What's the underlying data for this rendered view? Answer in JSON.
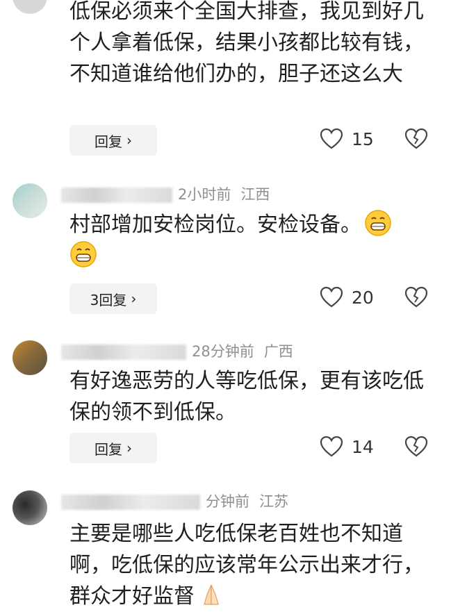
{
  "comments": [
    {
      "text": "低保必须来个全国大排查，我见到好几个人拿着低保，结果小孩都比较有钱，不知道谁给他们办的，胆子还这么大",
      "reply_label": "回复",
      "likes": "15"
    },
    {
      "time": "2小时前",
      "location": "江西",
      "text": "村部增加安检岗位。安检设备。",
      "reply_label": "3回复",
      "likes": "20"
    },
    {
      "time": "28分钟前",
      "location": "广西",
      "text": "有好逸恶劳的人等吃低保，更有该吃低保的领不到低保。",
      "reply_label": "回复",
      "likes": "14"
    },
    {
      "time": "分钟前",
      "location": "江苏",
      "text": "主要是哪些人吃低保老百姓也不知道啊，吃低保的应该常年公示出来才行，群众才好监督"
    }
  ],
  "icons": {
    "like": "heart-outline-icon",
    "dislike": "broken-heart-icon",
    "reply_arrow": "chevron-right-icon"
  },
  "colors": {
    "text": "#1f1f1f",
    "meta": "#8f8f8f",
    "reply_bg": "#f3f3f3"
  }
}
